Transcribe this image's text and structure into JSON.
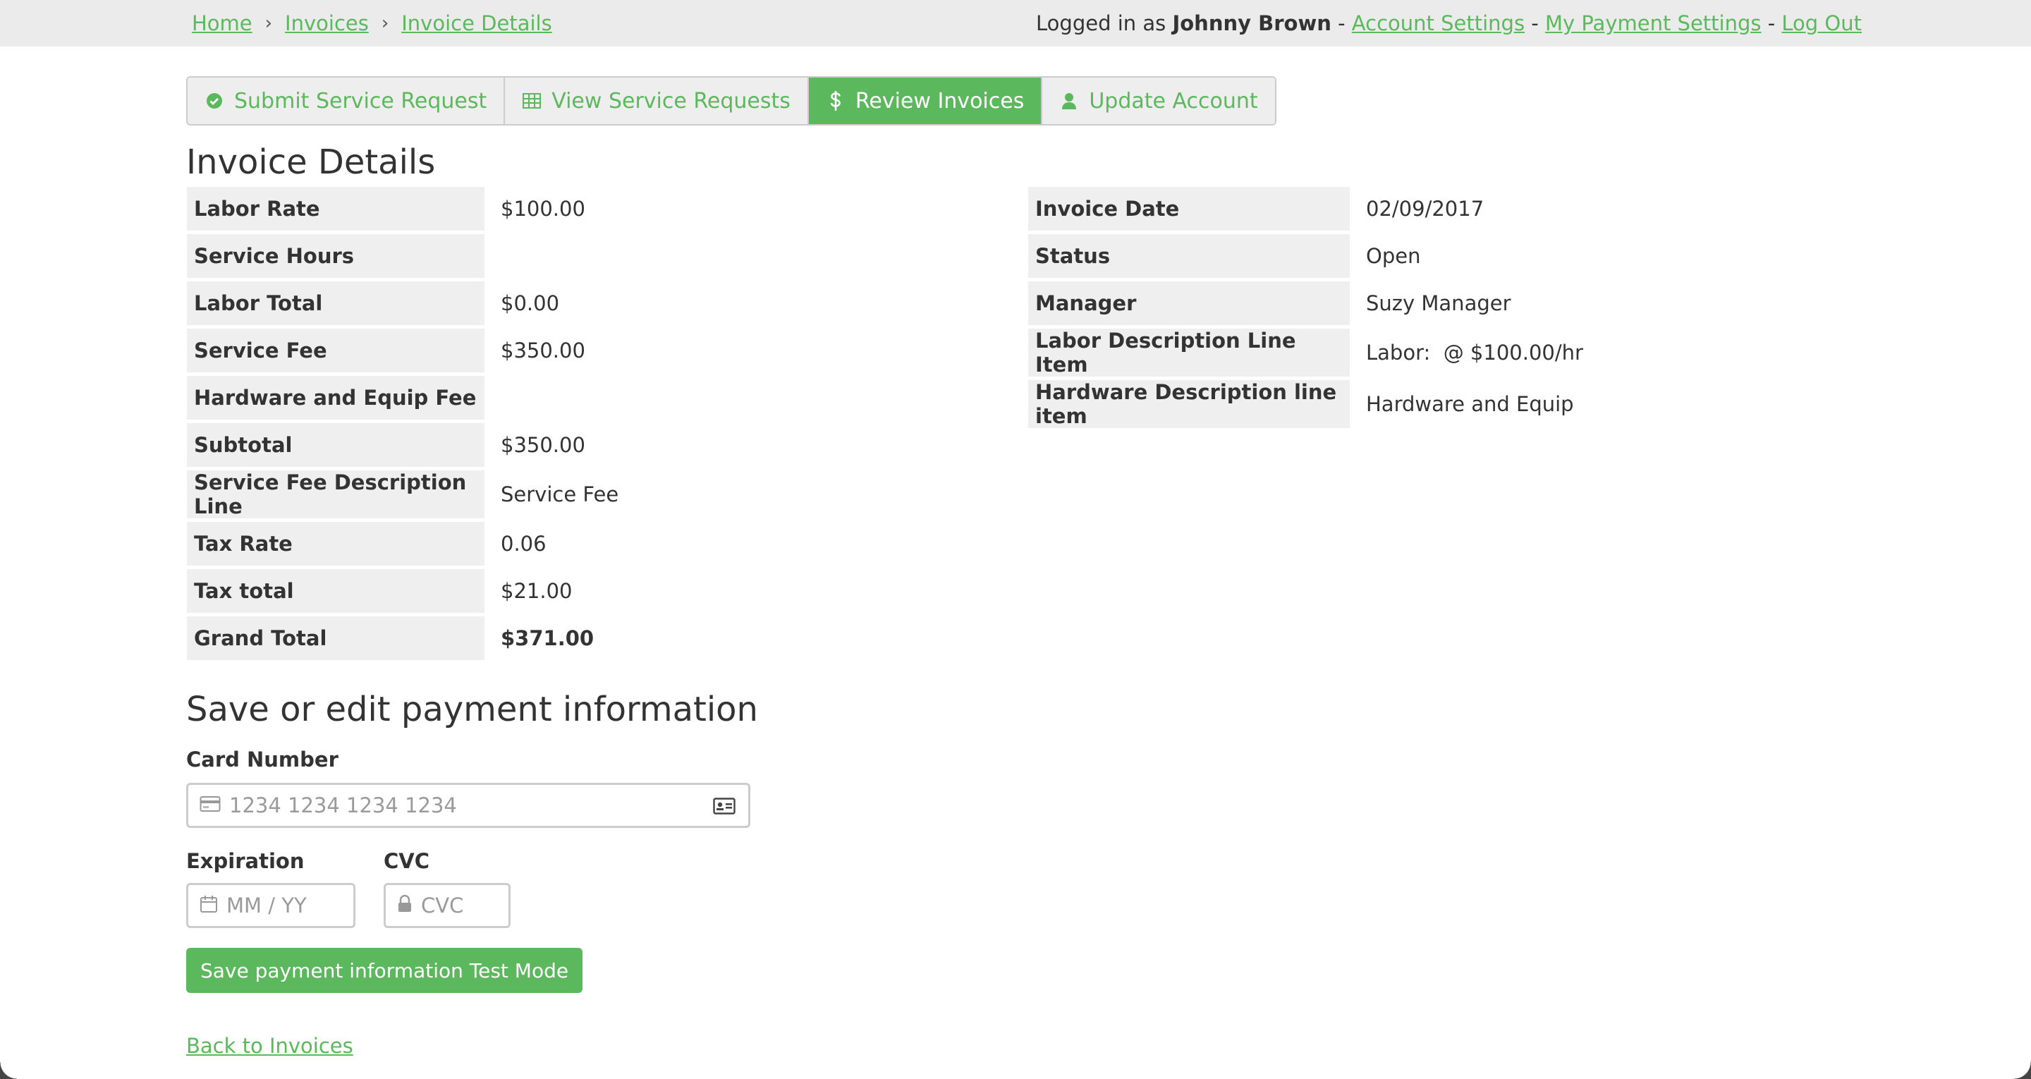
{
  "colors": {
    "accent": "#5cb85c",
    "topbar_bg": "#ebebeb",
    "label_bg": "#efefef"
  },
  "breadcrumb": {
    "items": [
      "Home",
      "Invoices",
      "Invoice Details"
    ],
    "separator": "›"
  },
  "userbar": {
    "logged_in_prefix": "Logged in as ",
    "user_name": "Johnny Brown",
    "dash": " - ",
    "account_settings": "Account Settings",
    "payment_settings": "My Payment Settings",
    "logout": "Log Out"
  },
  "tabs": [
    {
      "label": "Submit Service Request",
      "icon": "check-circle-icon",
      "active": false
    },
    {
      "label": "View Service Requests",
      "icon": "table-icon",
      "active": false
    },
    {
      "label": "Review Invoices",
      "icon": "dollar-icon",
      "active": true
    },
    {
      "label": "Update Account",
      "icon": "user-icon",
      "active": false
    }
  ],
  "page_title": "Invoice Details",
  "details_left": [
    {
      "label": "Labor Rate",
      "value": "$100.00"
    },
    {
      "label": "Service Hours",
      "value": ""
    },
    {
      "label": "Labor Total",
      "value": "$0.00"
    },
    {
      "label": "Service Fee",
      "value": "$350.00"
    },
    {
      "label": "Hardware and Equip Fee",
      "value": ""
    },
    {
      "label": "Subtotal",
      "value": "$350.00"
    },
    {
      "label": "Service Fee Description Line",
      "value": "Service Fee"
    },
    {
      "label": "Tax Rate",
      "value": "0.06"
    },
    {
      "label": "Tax total",
      "value": "$21.00"
    },
    {
      "label": "Grand Total",
      "value": "$371.00"
    }
  ],
  "details_right": [
    {
      "label": "Invoice Date",
      "value": "02/09/2017"
    },
    {
      "label": "Status",
      "value": "Open"
    },
    {
      "label": "Manager",
      "value": "Suzy Manager"
    },
    {
      "label": "Labor Description Line Item",
      "value": "Labor:  @ $100.00/hr"
    },
    {
      "label": "Hardware Description line item",
      "value": "Hardware and Equip"
    }
  ],
  "payment": {
    "heading": "Save or edit payment information",
    "card_label": "Card Number",
    "card_placeholder": "1234 1234 1234 1234",
    "expiration_label": "Expiration",
    "expiration_placeholder": "MM / YY",
    "cvc_label": "CVC",
    "cvc_placeholder": "CVC",
    "save_button": "Save payment information Test Mode"
  },
  "back_link": "Back to Invoices"
}
